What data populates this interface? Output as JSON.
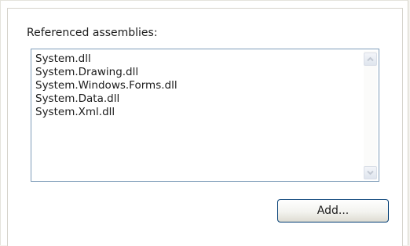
{
  "referenced_assemblies": {
    "label": "Referenced assemblies:",
    "items": [
      "System.dll",
      "System.Drawing.dll",
      "System.Windows.Forms.dll",
      "System.Data.dll",
      "System.Xml.dll"
    ]
  },
  "actions": {
    "add_label": "Add..."
  },
  "icons": {
    "scroll_up": "chevron-up-icon",
    "scroll_down": "chevron-down-icon"
  },
  "colors": {
    "list_border": "#7f9db9",
    "button_border": "#003c74",
    "scroll_arrow_disabled": "#c2c8d3"
  }
}
